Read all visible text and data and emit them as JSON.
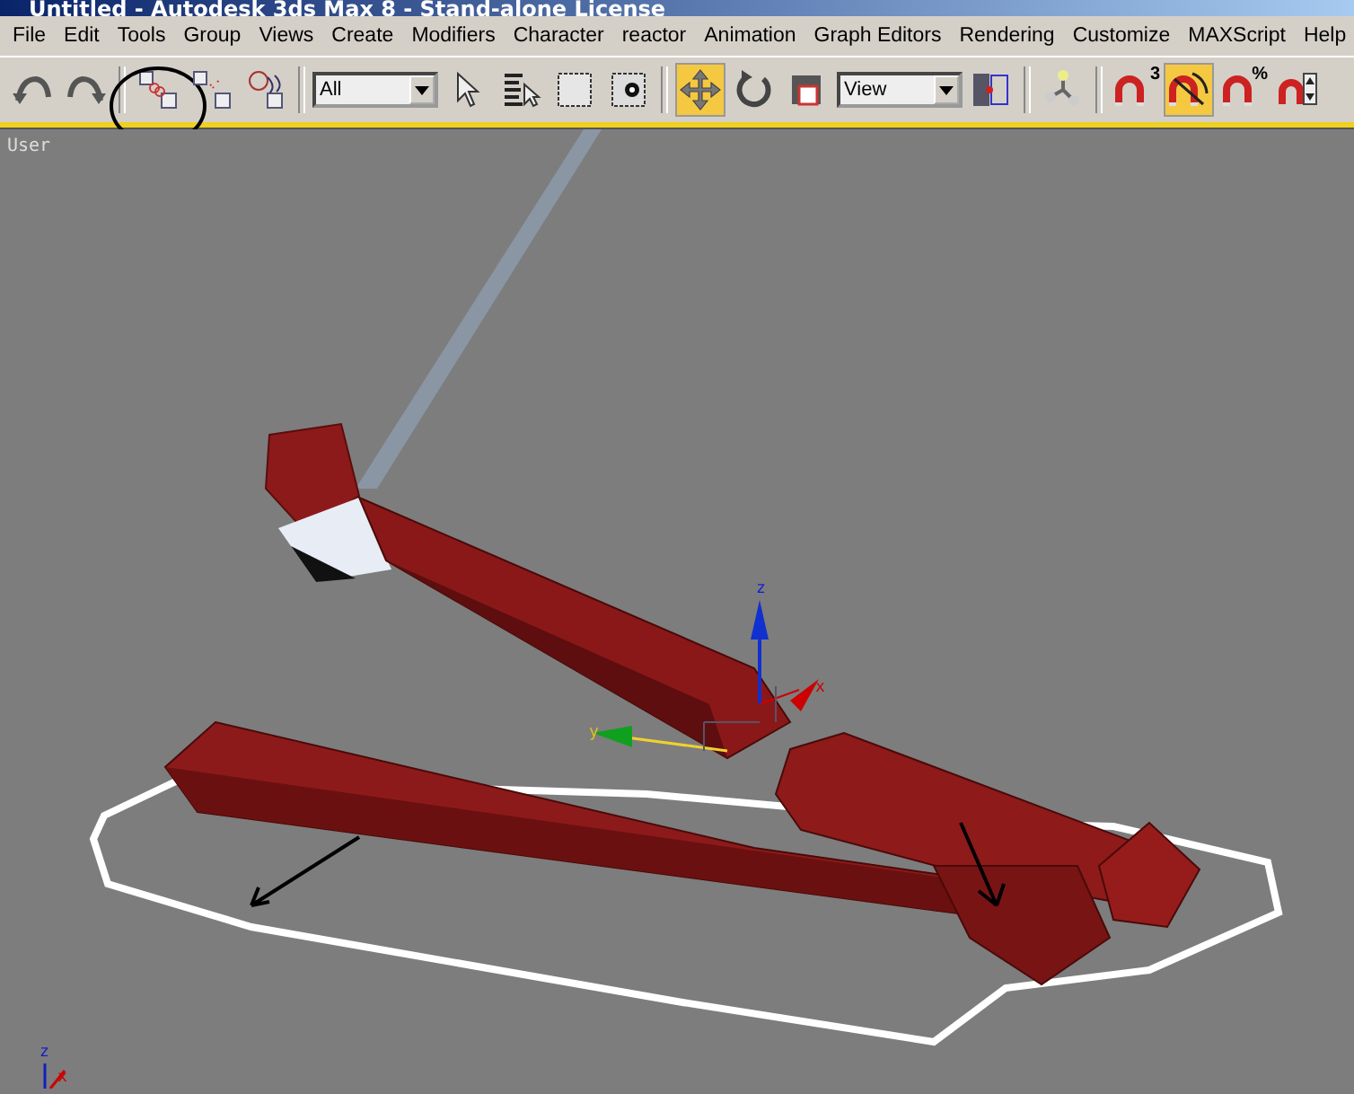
{
  "window": {
    "title": "Untitled - Autodesk 3ds Max 8  - Stand-alone License"
  },
  "menu": [
    "File",
    "Edit",
    "Tools",
    "Group",
    "Views",
    "Create",
    "Modifiers",
    "Character",
    "reactor",
    "Animation",
    "Graph Editors",
    "Rendering",
    "Customize",
    "MAXScript",
    "Help"
  ],
  "toolbar": [
    {
      "kind": "undo",
      "on": false
    },
    {
      "kind": "redo",
      "on": false
    },
    {
      "kind": "sep"
    },
    {
      "kind": "link",
      "on": false,
      "circled": true
    },
    {
      "kind": "unlink",
      "on": false
    },
    {
      "kind": "bind",
      "on": false
    },
    {
      "kind": "sep"
    },
    {
      "kind": "dropdown",
      "value": "All"
    },
    {
      "kind": "select",
      "on": false
    },
    {
      "kind": "select-by-name",
      "on": false
    },
    {
      "kind": "region",
      "on": false
    },
    {
      "kind": "crossing",
      "on": false
    },
    {
      "kind": "sep"
    },
    {
      "kind": "move",
      "on": true
    },
    {
      "kind": "rotate",
      "on": false
    },
    {
      "kind": "scale",
      "on": false
    },
    {
      "kind": "dropdown",
      "value": "View"
    },
    {
      "kind": "pivot",
      "on": false
    },
    {
      "kind": "sep"
    },
    {
      "kind": "manipulate",
      "on": false
    },
    {
      "kind": "sep"
    },
    {
      "kind": "snap",
      "on": false,
      "label": "3"
    },
    {
      "kind": "angle-snap",
      "on": true
    },
    {
      "kind": "percent-snap",
      "on": false,
      "label": "%"
    },
    {
      "kind": "spinner-snap",
      "on": false
    }
  ],
  "viewport": {
    "label": "User",
    "gizmo": {
      "x": "x",
      "y": "y",
      "z": "z"
    },
    "tripod": {
      "x": "x",
      "z": "z"
    }
  }
}
